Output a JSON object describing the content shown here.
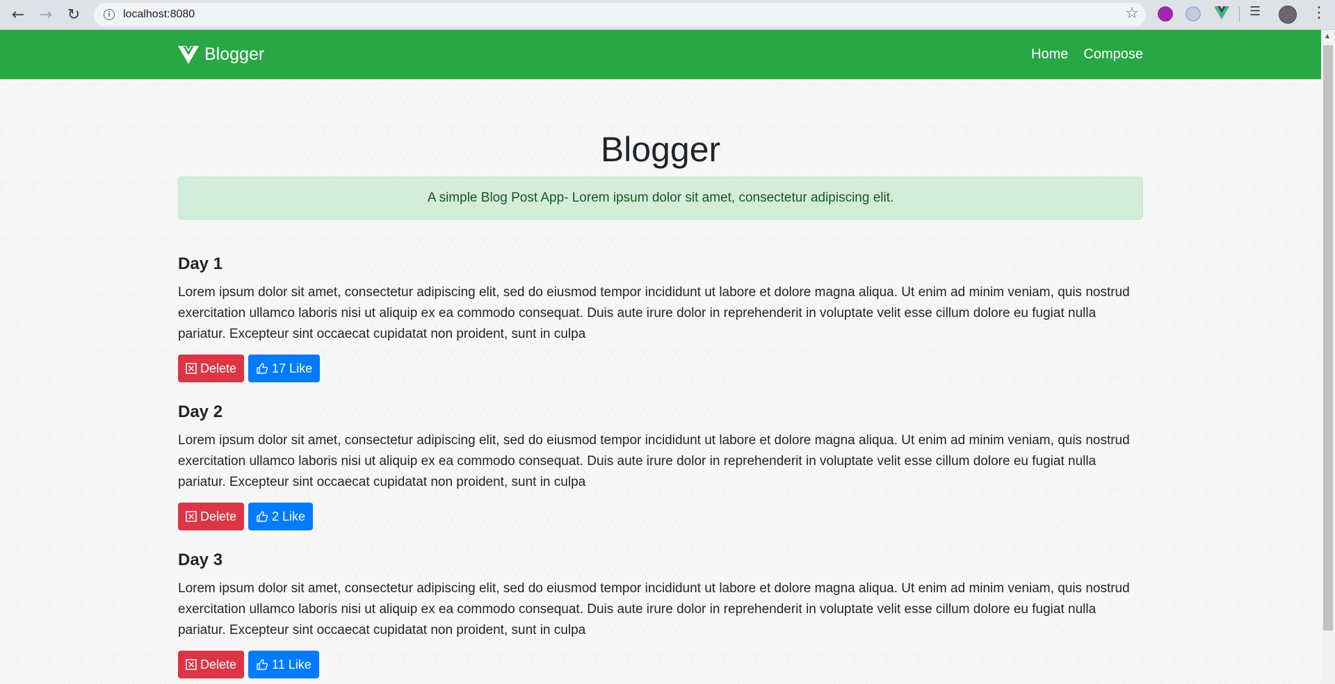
{
  "browser": {
    "url": "localhost:8080",
    "back_icon": "arrow-left-icon",
    "forward_icon": "arrow-right-icon",
    "reload_icon": "reload-icon"
  },
  "navbar": {
    "brand": "Blogger",
    "links": [
      {
        "label": "Home"
      },
      {
        "label": "Compose"
      }
    ],
    "color": "#28a745"
  },
  "main": {
    "title": "Blogger",
    "subtitle": "A simple Blog Post App- Lorem ipsum dolor sit amet, consectetur adipiscing elit."
  },
  "posts": [
    {
      "title": "Day 1",
      "body": "Lorem ipsum dolor sit amet, consectetur adipiscing elit, sed do eiusmod tempor incididunt ut labore et dolore magna aliqua. Ut enim ad minim veniam, quis nostrud exercitation ullamco laboris nisi ut aliquip ex ea commodo consequat. Duis aute irure dolor in reprehenderit in voluptate velit esse cillum dolore eu fugiat nulla pariatur. Excepteur sint occaecat cupidatat non proident, sunt in culpa",
      "delete_label": "Delete",
      "like_label": "17 Like"
    },
    {
      "title": "Day 2",
      "body": "Lorem ipsum dolor sit amet, consectetur adipiscing elit, sed do eiusmod tempor incididunt ut labore et dolore magna aliqua. Ut enim ad minim veniam, quis nostrud exercitation ullamco laboris nisi ut aliquip ex ea commodo consequat. Duis aute irure dolor in reprehenderit in voluptate velit esse cillum dolore eu fugiat nulla pariatur. Excepteur sint occaecat cupidatat non proident, sunt in culpa",
      "delete_label": "Delete",
      "like_label": "2 Like"
    },
    {
      "title": "Day 3",
      "body": "Lorem ipsum dolor sit amet, consectetur adipiscing elit, sed do eiusmod tempor incididunt ut labore et dolore magna aliqua. Ut enim ad minim veniam, quis nostrud exercitation ullamco laboris nisi ut aliquip ex ea commodo consequat. Duis aute irure dolor in reprehenderit in voluptate velit esse cillum dolore eu fugiat nulla pariatur. Excepteur sint occaecat cupidatat non proident, sunt in culpa",
      "delete_label": "Delete",
      "like_label": "11 Like"
    }
  ]
}
